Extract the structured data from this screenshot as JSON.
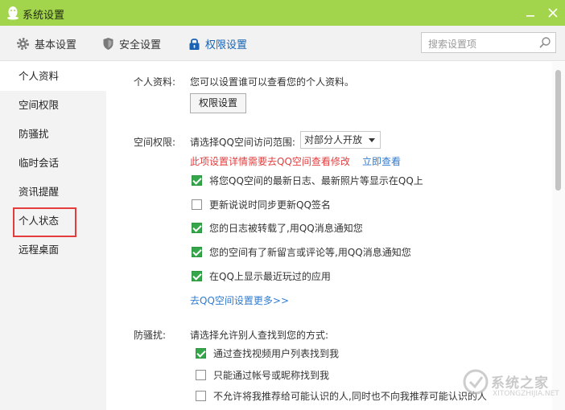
{
  "window": {
    "title": "系统设置",
    "accent_color": "#a3d54c",
    "title_icon": "qq-penguin-icon",
    "controls": [
      "minimize-icon",
      "close-icon"
    ]
  },
  "toolbar": {
    "tabs": [
      {
        "label": "基本设置",
        "icon": "gear-icon"
      },
      {
        "label": "安全设置",
        "icon": "shield-icon"
      },
      {
        "label": "权限设置",
        "icon": "lock-icon",
        "active": true,
        "color": "#1a63b3"
      }
    ],
    "search": {
      "placeholder": "搜索设置项",
      "icon": "search-icon"
    }
  },
  "sidebar": {
    "items": [
      {
        "label": "个人资料",
        "active": true
      },
      {
        "label": "空间权限"
      },
      {
        "label": "防骚扰"
      },
      {
        "label": "临时会话"
      },
      {
        "label": "资讯提醒"
      },
      {
        "label": "个人状态",
        "highlighted": true,
        "highlight_color": "#e43c3c"
      },
      {
        "label": "远程桌面"
      }
    ]
  },
  "content": {
    "profile": {
      "label": "个人资料:",
      "description": "您可以设置谁可以查看您的个人资料。",
      "button_label": "权限设置"
    },
    "space": {
      "label": "空间权限:",
      "scope_label": "请选择QQ空间访问范围:",
      "scope_value": "对部分人开放",
      "warning": "此项设置详情需要去QQ空间查看修改",
      "warning_color": "#e23e3e",
      "view_link": "立即查看",
      "options": [
        {
          "label": "将您QQ空间的最新日志、最新照片等显示在QQ上",
          "checked": true
        },
        {
          "label": "更新说说时同步更新QQ签名",
          "checked": false
        },
        {
          "label": "您的日志被转载了,用QQ消息通知您",
          "checked": true
        },
        {
          "label": "您的空间有了新留言或评论等,用QQ消息通知您",
          "checked": true
        },
        {
          "label": "在QQ上显示最近玩过的应用",
          "checked": true
        }
      ],
      "more_link": "去QQ空间设置更多>>"
    },
    "antiharass": {
      "label": "防骚扰:",
      "prompt": "请选择允许别人查找到您的方式:",
      "options": [
        {
          "label": "通过查找视频用户列表找到我",
          "checked": true
        },
        {
          "label": "只能通过帐号或昵称找到我",
          "checked": false
        },
        {
          "label": "不允许将我推荐给可能认识的人,同时也不向我推荐可能认识的人",
          "checked": false
        }
      ]
    }
  },
  "watermark": {
    "text": "系统之家",
    "sub": "XITONGZHIJIA.NET"
  }
}
